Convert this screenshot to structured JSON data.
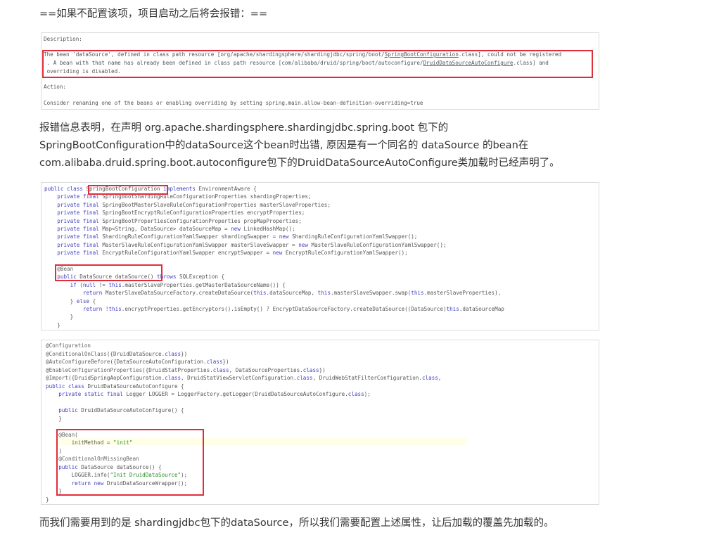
{
  "intro": "==如果不配置该项，项目启动之后将会报错：==",
  "error_box": {
    "description_label": "Description:",
    "line1_pre": "The bean 'dataSource', defined in class path resource [org/apache/shardingsphere/shardingjdbc/spring/boot/",
    "line1_link": "SpringBootConfiguration",
    "line1_post": ".class], could not be registered",
    "line2_pre": " . A bean with that name has already been defined in class path resource [com/alibaba/druid/spring/boot/autoconfigure/",
    "line2_link": "DruidDataSourceAutoConfigure",
    "line2_post": ".class] and",
    "line3": " overriding is disabled.",
    "action_label": "Action:",
    "action_text": "Consider renaming one of the beans or enabling overriding by setting spring.main.allow-bean-definition-overriding=true"
  },
  "explanation": {
    "line1": "报错信息表明，在声明 org.apache.shardingsphere.shardingjdbc.spring.boot 包下的",
    "line2": "SpringBootConfiguration中的dataSource这个bean时出错, 原因是有一个同名的 dataSource 的bean在",
    "line3": "com.alibaba.druid.spring.boot.autoconfigure包下的DruidDataSourceAutoConfigure类加载时已经声明了。"
  },
  "code1": [
    "public class SpringBootConfiguration implements EnvironmentAware {",
    "    private final SpringBootShardingRuleConfigurationProperties shardingProperties;",
    "    private final SpringBootMasterSlaveRuleConfigurationProperties masterSlaveProperties;",
    "    private final SpringBootEncryptRuleConfigurationProperties encryptProperties;",
    "    private final SpringBootPropertiesConfigurationProperties propMapProperties;",
    "    private final Map<String, DataSource> dataSourceMap = new LinkedHashMap();",
    "    private final ShardingRuleConfigurationYamlSwapper shardingSwapper = new ShardingRuleConfigurationYamlSwapper();",
    "    private final MasterSlaveRuleConfigurationYamlSwapper masterSlaveSwapper = new MasterSlaveRuleConfigurationYamlSwapper();",
    "    private final EncryptRuleConfigurationYamlSwapper encryptSwapper = new EncryptRuleConfigurationYamlSwapper();",
    "",
    "    @Bean",
    "    public DataSource dataSource() throws SQLException {",
    "        if (null != this.masterSlaveProperties.getMasterDataSourceName()) {",
    "            return MasterSlaveDataSourceFactory.createDataSource(this.dataSourceMap, this.masterSlaveSwapper.swap(this.masterSlaveProperties),",
    "        } else {",
    "            return !this.encryptProperties.getEncryptors().isEmpty() ? EncryptDataSourceFactory.createDataSource((DataSource)this.dataSourceMap",
    "        }",
    "    }"
  ],
  "code2": [
    "@Configuration",
    "@ConditionalOnClass({DruidDataSource.class})",
    "@AutoConfigureBefore({DataSourceAutoConfiguration.class})",
    "@EnableConfigurationProperties({DruidStatProperties.class, DataSourceProperties.class})",
    "@Import({DruidSpringAopConfiguration.class, DruidStatViewServletConfiguration.class, DruidWebStatFilterConfiguration.class,",
    "public class DruidDataSourceAutoConfigure {",
    "    private static final Logger LOGGER = LoggerFactory.getLogger(DruidDataSourceAutoConfigure.class);",
    "",
    "    public DruidDataSourceAutoConfigure() {",
    "    }",
    "",
    "    @Bean(",
    "        initMethod = \"init\"",
    "    )",
    "    @ConditionalOnMissingBean",
    "    public DataSource dataSource() {",
    "        LOGGER.info(\"Init DruidDataSource\");",
    "        return new DruidDataSourceWrapper();",
    "    }",
    "}"
  ],
  "conclusion": "而我们需要用到的是 shardingjdbc包下的dataSource，所以我们需要配置上述属性，让后加载的覆盖先加载的。",
  "colors": {
    "highlight_box": "#e22c3a",
    "keyword": "#3f3fbf",
    "string": "#2a8a2a"
  }
}
